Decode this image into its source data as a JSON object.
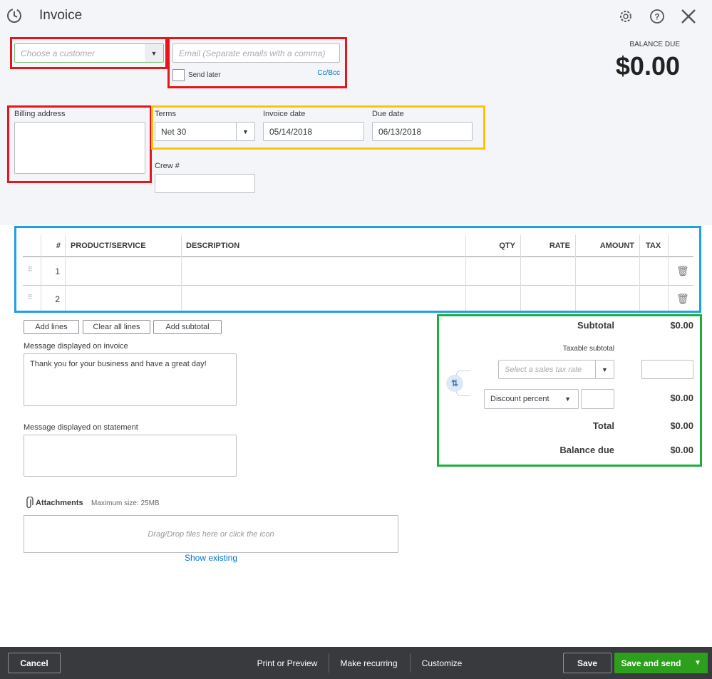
{
  "header": {
    "title": "Invoice",
    "balance_label": "BALANCE DUE",
    "balance": "$0.00"
  },
  "customer": {
    "placeholder": "Choose a customer"
  },
  "email": {
    "placeholder": "Email (Separate emails with a comma)",
    "send_later": "Send later",
    "cc_bcc": "Cc/Bcc"
  },
  "billing": {
    "label": "Billing address"
  },
  "terms": {
    "label": "Terms",
    "value": "Net 30"
  },
  "invoice_date": {
    "label": "Invoice date",
    "value": "05/14/2018"
  },
  "due_date": {
    "label": "Due date",
    "value": "06/13/2018"
  },
  "crew": {
    "label": "Crew #"
  },
  "table": {
    "headers": [
      "#",
      "PRODUCT/SERVICE",
      "DESCRIPTION",
      "QTY",
      "RATE",
      "AMOUNT",
      "TAX"
    ],
    "rows": [
      {
        "num": "1"
      },
      {
        "num": "2"
      }
    ]
  },
  "line_buttons": {
    "add_lines": "Add lines",
    "clear_all": "Clear all lines",
    "add_subtotal": "Add subtotal"
  },
  "message_invoice": {
    "label": "Message displayed on invoice",
    "value": "Thank you for your business and have a great day!"
  },
  "message_statement": {
    "label": "Message displayed on statement"
  },
  "attachments": {
    "label": "Attachments",
    "max": "Maximum size: 25MB",
    "drop": "Drag/Drop files here or click the icon",
    "show_existing": "Show existing"
  },
  "totals": {
    "subtotal_label": "Subtotal",
    "subtotal": "$0.00",
    "taxable_label": "Taxable subtotal",
    "tax_placeholder": "Select a sales tax rate",
    "discount_type": "Discount percent",
    "discount_amount": "$0.00",
    "total_label": "Total",
    "total": "$0.00",
    "balance_label": "Balance due",
    "balance": "$0.00"
  },
  "footer": {
    "cancel": "Cancel",
    "print": "Print or Preview",
    "recurring": "Make recurring",
    "customize": "Customize",
    "save": "Save",
    "save_send": "Save and send"
  },
  "colors": {
    "green": "#2ca01c",
    "link": "#0077c5",
    "red_box": "#e8131b",
    "yellow_box": "#fcc30b",
    "blue_box": "#1da1e6",
    "green_box": "#1ab03a"
  }
}
